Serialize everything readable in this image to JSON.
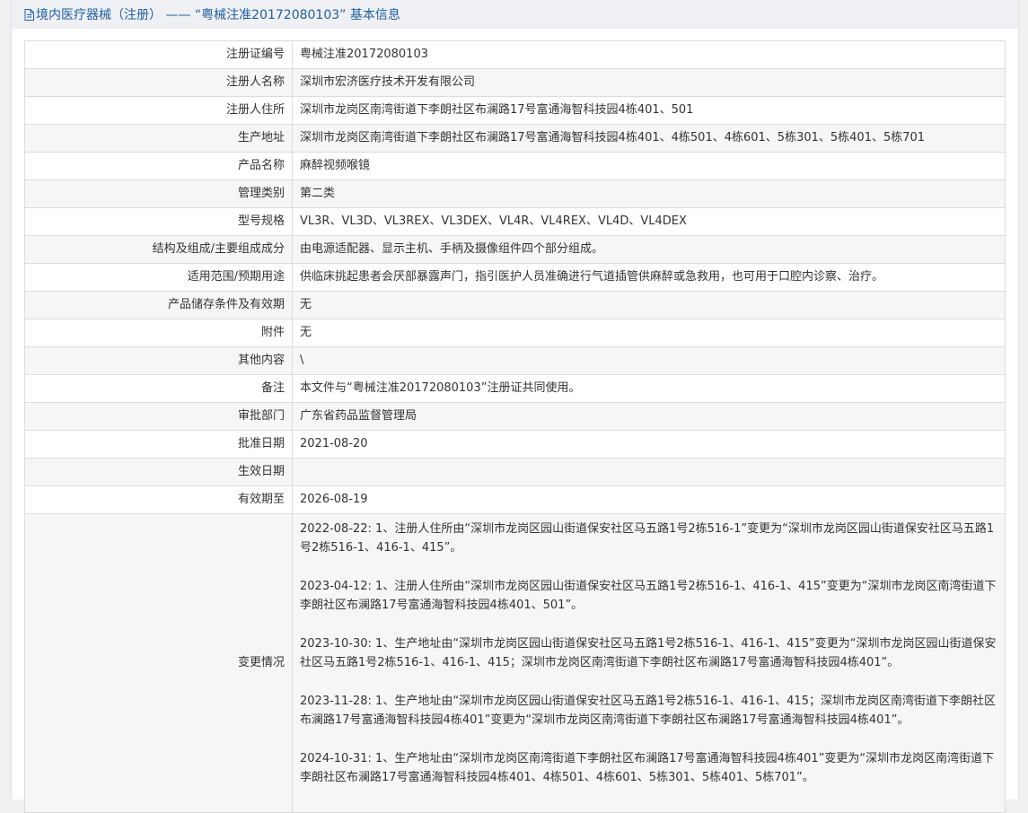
{
  "page_title": "境内医疗器械（注册） —— “粤械注准20172080103” 基本信息",
  "rows": [
    {
      "label": "注册证编号",
      "value": "粤械注准20172080103"
    },
    {
      "label": "注册人名称",
      "value": "深圳市宏济医疗技术开发有限公司"
    },
    {
      "label": "注册人住所",
      "value": "深圳市龙岗区南湾街道下李朗社区布澜路17号富通海智科技园4栋401、501"
    },
    {
      "label": "生产地址",
      "value": "深圳市龙岗区南湾街道下李朗社区布澜路17号富通海智科技园4栋401、4栋501、4栋601、5栋301、5栋401、5栋701"
    },
    {
      "label": "产品名称",
      "value": "麻醉视频喉镜"
    },
    {
      "label": "管理类别",
      "value": "第二类"
    },
    {
      "label": "型号规格",
      "value": "VL3R、VL3D、VL3REX、VL3DEX、VL4R、VL4REX、VL4D、VL4DEX"
    },
    {
      "label": "结构及组成/主要组成成分",
      "value": "由电源适配器、显示主机、手柄及摄像组件四个部分组成。"
    },
    {
      "label": "适用范围/预期用途",
      "value": "供临床挑起患者会厌部暴露声门，指引医护人员准确进行气道插管供麻醉或急救用，也可用于口腔内诊察、治疗。"
    },
    {
      "label": "产品储存条件及有效期",
      "value": "无"
    },
    {
      "label": "附件",
      "value": "无"
    },
    {
      "label": "其他内容",
      "value": "\\"
    },
    {
      "label": "备注",
      "value": "本文件与“粤械注准20172080103”注册证共同使用。"
    },
    {
      "label": "审批部门",
      "value": "广东省药品监督管理局"
    },
    {
      "label": "批准日期",
      "value": "2021-08-20"
    },
    {
      "label": "生效日期",
      "value": ""
    },
    {
      "label": "有效期至",
      "value": "2026-08-19"
    }
  ],
  "change": {
    "label": "变更情况",
    "entries": [
      "2022-08-22: 1、注册人住所由“深圳市龙岗区园山街道保安社区马五路1号2栋516-1”变更为“深圳市龙岗区园山街道保安社区马五路1号2栋516-1、416-1、415”。",
      "2023-04-12: 1、注册人住所由“深圳市龙岗区园山街道保安社区马五路1号2栋516-1、416-1、415”变更为“深圳市龙岗区南湾街道下李朗社区布澜路17号富通海智科技园4栋401、501”。",
      "2023-10-30: 1、生产地址由“深圳市龙岗区园山街道保安社区马五路1号2栋516-1、416-1、415”变更为“深圳市龙岗区园山街道保安社区马五路1号2栋516-1、416-1、415；深圳市龙岗区南湾街道下李朗社区布澜路17号富通海智科技园4栋401”。",
      "2023-11-28: 1、生产地址由“深圳市龙岗区园山街道保安社区马五路1号2栋516-1、416-1、415；深圳市龙岗区南湾街道下李朗社区布澜路17号富通海智科技园4栋401”变更为“深圳市龙岗区南湾街道下李朗社区布澜路17号富通海智科技园4栋401”。",
      "2024-10-31: 1、生产地址由“深圳市龙岗区南湾街道下李朗社区布澜路17号富通海智科技园4栋401”变更为“深圳市龙岗区南湾街道下李朗社区布澜路17号富通海智科技园4栋401、4栋501、4栋601、5栋301、5栋401、5栋701”。"
    ]
  },
  "colors": {
    "title_text": "#1f5fa3",
    "title_bar_bg": "#eef0f3",
    "row_alt_bg": "#f6f6f6",
    "border": "#dcdcdc"
  },
  "icons": {
    "title_icon": "document-icon"
  }
}
